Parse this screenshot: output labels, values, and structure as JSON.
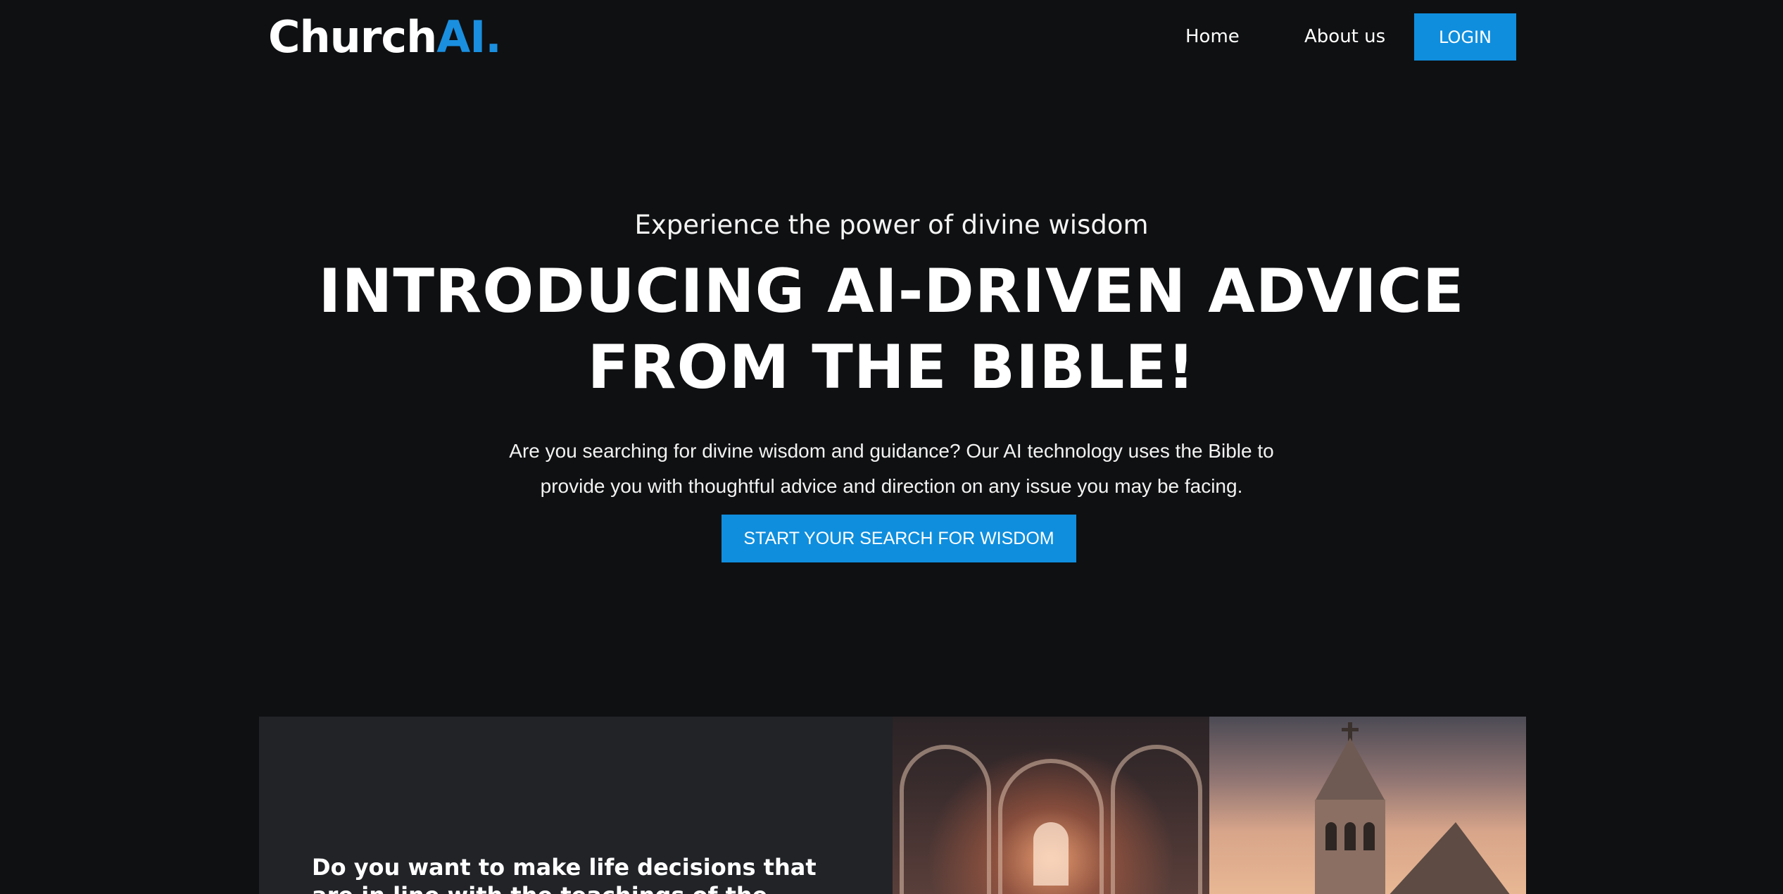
{
  "brand": {
    "name_primary": "Church",
    "name_accent": "AI.",
    "accent_color": "#1a8fe0"
  },
  "nav": {
    "home_label": "Home",
    "about_label": "About us",
    "login_label": "LOGIN"
  },
  "hero": {
    "eyebrow": "Experience the power of divine wisdom",
    "headline": "INTRODUCING AI-DRIVEN ADVICE FROM THE BIBLE!",
    "lead": "Are you searching for divine wisdom and guidance? Our AI technology uses the Bible to provide you with thoughtful advice and direction on any issue you may be facing.",
    "cta_label": "START YOUR SEARCH FOR WISDOM"
  },
  "feature": {
    "title": "Do you want to make life decisions that are in line with the teachings of the Bible?"
  },
  "colors": {
    "background": "#0f1012",
    "card": "#222327",
    "button": "#0f8ede"
  }
}
